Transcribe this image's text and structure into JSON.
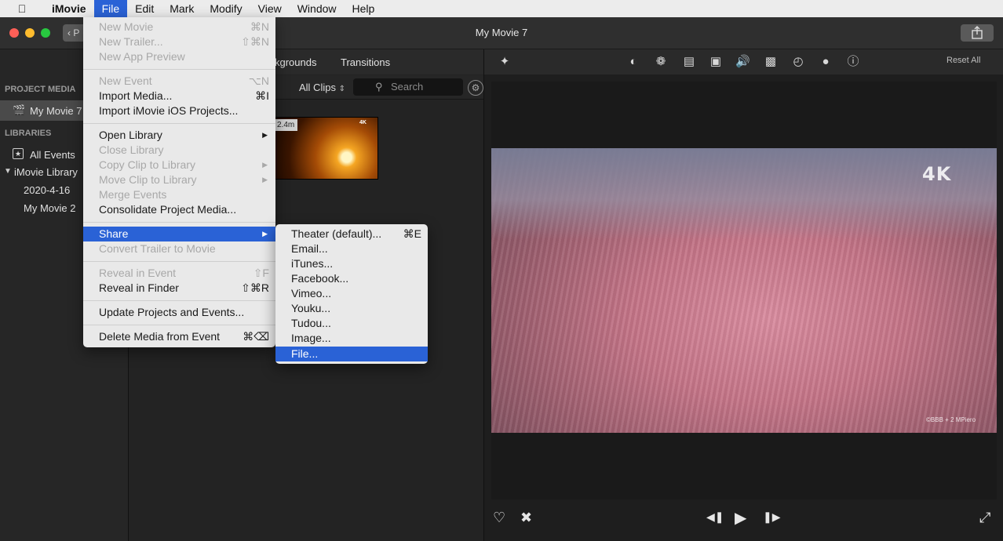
{
  "menubar": {
    "app_name": "iMovie",
    "items": [
      "File",
      "Edit",
      "Mark",
      "Modify",
      "View",
      "Window",
      "Help"
    ]
  },
  "window": {
    "title": "My Movie 7",
    "back_label": "P"
  },
  "sidebar": {
    "project_media_header": "PROJECT MEDIA",
    "project_item": "My Movie 7",
    "libraries_header": "LIBRARIES",
    "all_events": "All Events",
    "library_name": "iMovie Library",
    "event_1": "2020-4-16",
    "event_2": "My Movie 2"
  },
  "browser": {
    "tab_backgrounds": "kgrounds",
    "tab_transitions": "Transitions",
    "clips_filter": "All Clips",
    "search_placeholder": "Search",
    "clip_duration": "2.4m"
  },
  "viewer": {
    "reset_all": "Reset All",
    "badge": "4K",
    "watermark": "©BBB + 2 MPiero"
  },
  "file_menu": {
    "items": [
      {
        "label": "New Movie",
        "shortcut": "⌘N",
        "disabled": true
      },
      {
        "label": "New Trailer...",
        "shortcut": "⇧⌘N",
        "disabled": true
      },
      {
        "label": "New App Preview",
        "shortcut": "",
        "disabled": true
      },
      {
        "label": "New Event",
        "shortcut": "⌥N",
        "disabled": true
      },
      {
        "label": "Import Media...",
        "shortcut": "⌘I",
        "disabled": false
      },
      {
        "label": "Import iMovie iOS Projects...",
        "shortcut": "",
        "disabled": false
      },
      {
        "label": "Open Library",
        "shortcut": "",
        "disabled": false
      },
      {
        "label": "Close Library",
        "shortcut": "",
        "disabled": true
      },
      {
        "label": "Copy Clip to Library",
        "shortcut": "",
        "disabled": true
      },
      {
        "label": "Move Clip to Library",
        "shortcut": "",
        "disabled": true
      },
      {
        "label": "Merge Events",
        "shortcut": "",
        "disabled": true
      },
      {
        "label": "Consolidate Project Media...",
        "shortcut": "",
        "disabled": false
      },
      {
        "label": "Share",
        "shortcut": "",
        "disabled": false
      },
      {
        "label": "Convert Trailer to Movie",
        "shortcut": "",
        "disabled": true
      },
      {
        "label": "Reveal in Event",
        "shortcut": "⇧F",
        "disabled": true
      },
      {
        "label": "Reveal in Finder",
        "shortcut": "⇧⌘R",
        "disabled": false
      },
      {
        "label": "Update Projects and Events...",
        "shortcut": "",
        "disabled": false
      },
      {
        "label": "Delete Media from Event",
        "shortcut": "⌘⌫",
        "disabled": false
      }
    ]
  },
  "share_menu": {
    "items": [
      {
        "label": "Theater (default)...",
        "shortcut": "⌘E"
      },
      {
        "label": "Email...",
        "shortcut": ""
      },
      {
        "label": "iTunes...",
        "shortcut": ""
      },
      {
        "label": "Facebook...",
        "shortcut": ""
      },
      {
        "label": "Vimeo...",
        "shortcut": ""
      },
      {
        "label": "Youku...",
        "shortcut": ""
      },
      {
        "label": "Tudou...",
        "shortcut": ""
      },
      {
        "label": "Image...",
        "shortcut": ""
      },
      {
        "label": "File...",
        "shortcut": ""
      }
    ]
  },
  "colors": {
    "highlight": "#2a62d6",
    "menu_bg": "#e9e9e9",
    "window_bg": "#1e1e1e"
  }
}
